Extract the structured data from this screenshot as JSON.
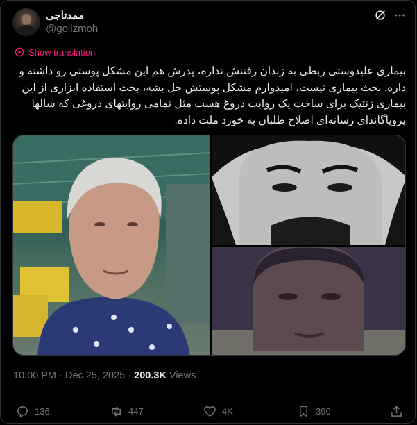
{
  "author": {
    "name": "ممدتاجی",
    "handle": "@golizmoh"
  },
  "translate_label": "Show translation",
  "tweet": {
    "text": "بیماری علیدوستی ربطی به زندان رفتنش نداره، پدرش هم این مشکل پوستی رو داشته و داره. بحث بیماری نیست، امیدوارم مشکل پوستش حل بشه، بحث استفاده ابزاری از این بیماری ژنتیک برای ساخت یک روایت دروغ هست مثل تمامی روایتهای دروغی که سالها پروپاگاندای رسانه‌ای اصلاح طلبان به خورد ملت داده."
  },
  "meta": {
    "time": "10:00 PM",
    "sep": " · ",
    "date": "Dec 25, 2025",
    "sep2": " · ",
    "views_count": "200.3K",
    "views_label": " Views"
  },
  "actions": {
    "replies": "136",
    "reposts": "447",
    "likes": "4K",
    "bookmarks": "390"
  },
  "icons": [
    "grok-icon",
    "more-icon",
    "translate-icon",
    "reply-icon",
    "repost-icon",
    "like-icon",
    "bookmark-icon",
    "share-icon"
  ],
  "colors": {
    "accent_pink": "#f91880",
    "text": "#e7e9ea",
    "muted": "#71767b",
    "border": "#2f3336"
  }
}
